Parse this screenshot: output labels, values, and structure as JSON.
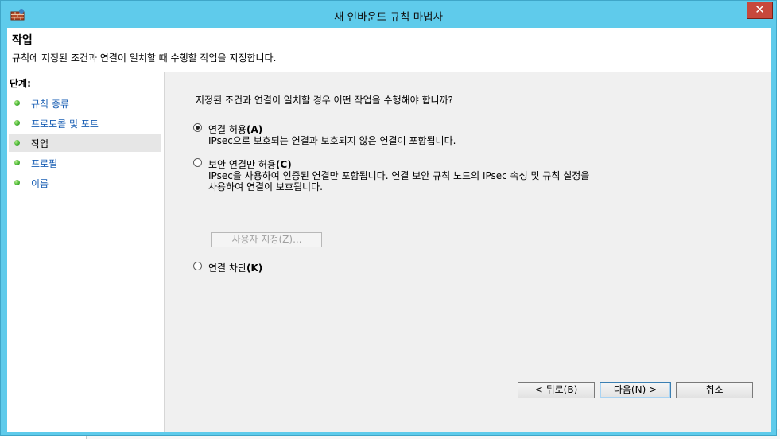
{
  "window": {
    "title": "새 인바운드 규칙 마법사",
    "close_label": "✕"
  },
  "header": {
    "title": "작업",
    "description": "규칙에 지정된 조건과 연결이 일치할 때 수행할 작업을 지정합니다."
  },
  "steps": {
    "heading": "단계:",
    "items": [
      {
        "label": "규칙 종류",
        "state": "link"
      },
      {
        "label": "프로토콜 및 포트",
        "state": "link"
      },
      {
        "label": "작업",
        "state": "current"
      },
      {
        "label": "프로필",
        "state": "link"
      },
      {
        "label": "이름",
        "state": "link"
      }
    ]
  },
  "main": {
    "question": "지정된 조건과 연결이 일치할 경우 어떤 작업을 수행해야 합니까?",
    "options": [
      {
        "label": "연결 허용",
        "hotkey": "(A)",
        "checked": true,
        "desc": [
          "IPsec으로 보호되는 연결과 보호되지 않은 연결이 포함됩니다."
        ]
      },
      {
        "label": "보안 연결만 허용",
        "hotkey": "(C)",
        "checked": false,
        "desc": [
          "IPsec을 사용하여 인증된 연결만 포함됩니다. 연결 보안 규칙 노드의 IPsec 속성 및 규칙 설정을",
          "사용하여 연결이 보호됩니다."
        ]
      },
      {
        "label": "연결 차단",
        "hotkey": "(K)",
        "checked": false,
        "desc": []
      }
    ],
    "customize_label": "사용자 지정(Z)..."
  },
  "buttons": {
    "back": "< 뒤로(B)",
    "next": "다음(N) >",
    "cancel": "취소"
  },
  "icons": {
    "app": "firewall-icon",
    "step_bullet": "green-dot-icon"
  }
}
